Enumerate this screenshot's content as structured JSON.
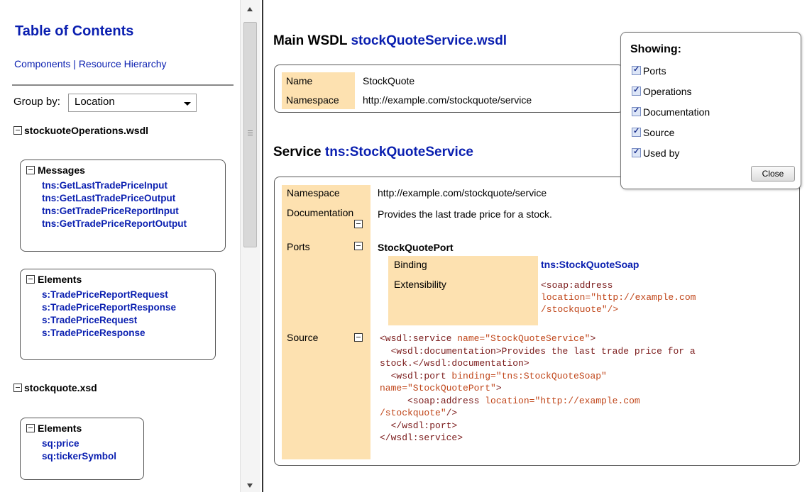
{
  "toc": {
    "title": "Table of Contents",
    "links": [
      "Components",
      "Resource Hierarchy"
    ],
    "separator": " | ",
    "group_by_label": "Group by:",
    "group_by_value": "Location"
  },
  "files": [
    {
      "name": "stockuoteOperations.wsdl",
      "groups": [
        {
          "title": "Messages",
          "items": [
            "tns:GetLastTradePriceInput",
            "tns:GetLastTradePriceOutput",
            "tns:GetTradePriceReportInput",
            "tns:GetTradePriceReportOutput"
          ]
        },
        {
          "title": "Elements",
          "items": [
            "s:TradePriceReportRequest",
            "s:TradePriceReportResponse",
            "s:TradePriceRequest",
            "s:TradePriceResponse"
          ]
        }
      ]
    },
    {
      "name": "stockquote.xsd",
      "groups": [
        {
          "title": "Elements",
          "items": [
            "sq:price",
            "sq:tickerSymbol"
          ]
        }
      ]
    }
  ],
  "main_wsdl": {
    "heading_prefix": "Main WSDL",
    "heading_value": "stockQuoteService.wsdl",
    "name_label": "Name",
    "name_value": "StockQuote",
    "namespace_label": "Namespace",
    "namespace_value": "http://example.com/stockquote/service"
  },
  "service": {
    "heading_prefix": "Service",
    "heading_value": "tns:StockQuoteService",
    "namespace_label": "Namespace",
    "namespace_value": "http://example.com/stockquote/service",
    "documentation_label": "Documentation",
    "documentation_value": "Provides the last trade price for a stock.",
    "ports_label": "Ports",
    "port_name": "StockQuotePort",
    "binding_label": "Binding",
    "binding_value": "tns:StockQuoteSoap",
    "extensibility_label": "Extensibility",
    "ext_line1": "<soap:address",
    "ext_line2": "location=\"http://example.com",
    "ext_line3": "/stockquote\"/>",
    "source_label": "Source",
    "source_lines": [
      {
        "tag": "<wsdl:service ",
        "attr": "name=\"StockQuoteService\"",
        "tail": ">"
      },
      {
        "tag": "  <wsdl:documentation>Provides the last trade price for a",
        "attr": "",
        "tail": ""
      },
      {
        "tag": "stock.</wsdl:documentation>",
        "attr": "",
        "tail": ""
      },
      {
        "tag": "  <wsdl:port ",
        "attr": "binding=\"tns:StockQuoteSoap\"",
        "tail": ""
      },
      {
        "tag": "",
        "attr": "name=\"StockQuotePort\"",
        "tail": ">"
      },
      {
        "tag": "     <soap:address ",
        "attr": "location=\"http://example.com",
        "tail": ""
      },
      {
        "tag": "",
        "attr": "/stockquote\"",
        "tail": "/>"
      },
      {
        "tag": "  </wsdl:port>",
        "attr": "",
        "tail": ""
      },
      {
        "tag": "</wsdl:service>",
        "attr": "",
        "tail": ""
      }
    ]
  },
  "showing": {
    "title": "Showing:",
    "options": [
      "Ports",
      "Operations",
      "Documentation",
      "Source",
      "Used by"
    ],
    "close_label": "Close"
  },
  "colors": {
    "link": "#0a1fb0",
    "label_bg": "#fde1b0",
    "attr": "#c0461a"
  },
  "icons": [
    "collapse-toggle-icon",
    "scroll-up-arrow-icon",
    "scroll-down-arrow-icon",
    "dropdown-caret-icon",
    "checkbox-check-icon"
  ]
}
